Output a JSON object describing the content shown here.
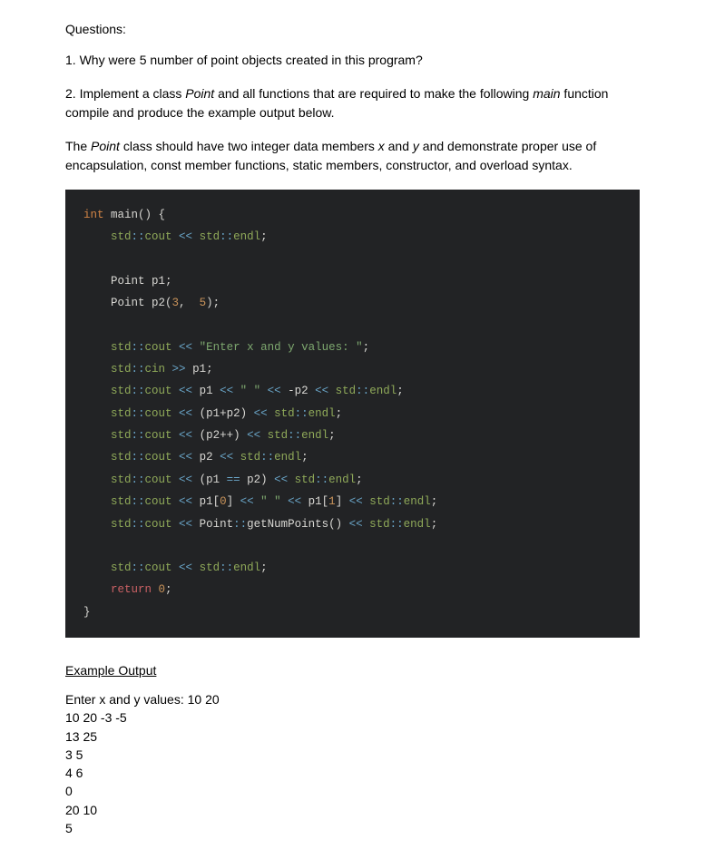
{
  "questions_heading": "Questions:",
  "question1": "1. Why were 5 number of point objects created in this program?",
  "question2_pre": "2. Implement a class ",
  "question2_point": "Point",
  "question2_mid": " and all functions that are required to make the following ",
  "question2_main": "main",
  "question2_post": " function compile and produce the example output below.",
  "para3_pre": "The ",
  "para3_point": "Point",
  "para3_mid": " class should have two integer data members ",
  "para3_x": "x",
  "para3_and": " and ",
  "para3_y": "y",
  "para3_post": " and demonstrate proper use of encapsulation, const member functions, static members, constructor, and overload syntax.",
  "code": {
    "l1": {
      "a": "int",
      "b": " main",
      "c": "() {"
    },
    "l2": {
      "a": "    std",
      "b": "::",
      "c": "cout ",
      "d": "<<",
      "e": " std",
      "f": "::",
      "g": "endl",
      "h": ";"
    },
    "l3": {
      "a": "    Point p1;"
    },
    "l4": {
      "a": "    Point p2",
      "b": "(",
      "c": "3",
      "d": ",  ",
      "e": "5",
      "f": ");"
    },
    "l5": {
      "a": "    std",
      "b": "::",
      "c": "cout ",
      "d": "<<",
      "e": " \"Enter x and y values: \"",
      "f": ";"
    },
    "l6": {
      "a": "    std",
      "b": "::",
      "c": "cin ",
      "d": ">>",
      "e": " p1",
      "f": ";"
    },
    "l7": {
      "a": "    std",
      "b": "::",
      "c": "cout ",
      "d": "<<",
      "e": " p1 ",
      "f": "<<",
      "g": " \" \" ",
      "h": "<<",
      "i": " -p2 ",
      "j": "<<",
      "k": " std",
      "l": "::",
      "m": "endl",
      "n": ";"
    },
    "l8": {
      "a": "    std",
      "b": "::",
      "c": "cout ",
      "d": "<<",
      "e": " (p1+p2) ",
      "f": "<<",
      "g": " std",
      "h": "::",
      "i": "endl",
      "j": ";"
    },
    "l9": {
      "a": "    std",
      "b": "::",
      "c": "cout ",
      "d": "<<",
      "e": " (p2++) ",
      "f": "<<",
      "g": " std",
      "h": "::",
      "i": "endl",
      "j": ";"
    },
    "l10": {
      "a": "    std",
      "b": "::",
      "c": "cout ",
      "d": "<<",
      "e": " p2 ",
      "f": "<<",
      "g": " std",
      "h": "::",
      "i": "endl",
      "j": ";"
    },
    "l11": {
      "a": "    std",
      "b": "::",
      "c": "cout ",
      "d": "<<",
      "e": " (p1 ",
      "f": "==",
      "g": " p2) ",
      "h": "<<",
      "i": " std",
      "j": "::",
      "k": "endl",
      "l": ";"
    },
    "l12": {
      "a": "    std",
      "b": "::",
      "c": "cout ",
      "d": "<<",
      "e": " p1[",
      "f": "0",
      "g": "] ",
      "h": "<<",
      "i": " \" \" ",
      "j": "<<",
      "k": " p1[",
      "l": "1",
      "m": "] ",
      "n": "<<",
      "o": " std",
      "p": "::",
      "q": "endl",
      "r": ";"
    },
    "l13": {
      "a": "    std",
      "b": "::",
      "c": "cout ",
      "d": "<<",
      "e": " Point",
      "f": "::",
      "g": "getNumPoints() ",
      "h": "<<",
      "i": " std",
      "j": "::",
      "k": "endl",
      "l": ";"
    },
    "l14": {
      "a": "    std",
      "b": "::",
      "c": "cout ",
      "d": "<<",
      "e": " std",
      "f": "::",
      "g": "endl",
      "h": ";"
    },
    "l15": {
      "a": "    return ",
      "b": "0",
      "c": ";"
    },
    "l16": {
      "a": "}"
    }
  },
  "example_heading": "Example Output",
  "output": [
    "Enter x and y values: 10 20",
    "10 20 -3 -5",
    "13 25",
    "3 5",
    "4 6",
    "0",
    "20 10",
    "5"
  ]
}
